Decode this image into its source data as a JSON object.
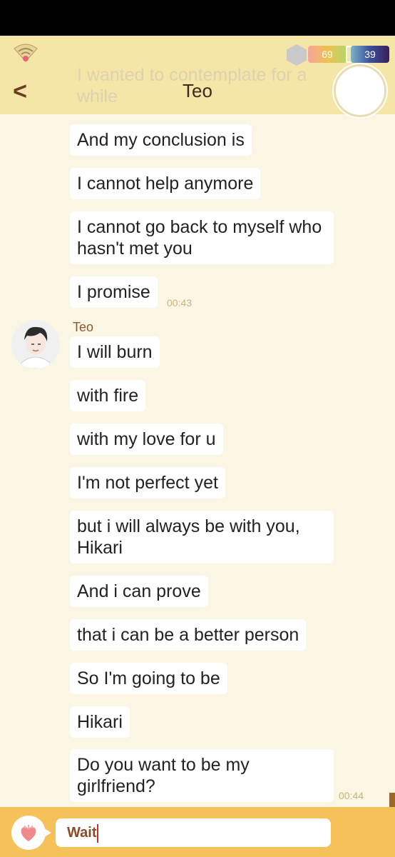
{
  "header": {
    "title": "Teo",
    "ghost_text": "I wanted to contemplate for a while",
    "meter_a_value": "69",
    "meter_b_value": "39",
    "back_label": "<"
  },
  "chat": {
    "sender_name": "Teo",
    "messages": [
      {
        "text": "And my conclusion is"
      },
      {
        "text": "I cannot help anymore"
      },
      {
        "text": "I cannot go back to myself who hasn't met you"
      },
      {
        "text": "I promise",
        "time": "00:43"
      },
      {
        "text": "I will burn"
      },
      {
        "text": "with fire"
      },
      {
        "text": "with my love for u"
      },
      {
        "text": "I'm not perfect yet"
      },
      {
        "text": "but i will always be with you, Hikari"
      },
      {
        "text": "And i can prove"
      },
      {
        "text": "that i can be a better person"
      },
      {
        "text": "So I'm going to be"
      },
      {
        "text": "Hikari"
      },
      {
        "text": "Do you want to be my girlfriend?",
        "time": "00:44"
      }
    ]
  },
  "input": {
    "value": "Wait"
  },
  "icons": {
    "wifi": "wifi-icon",
    "heart": "heart-icon",
    "hexagon": "hexagon-icon"
  },
  "colors": {
    "header_bg": "#f5e6a8",
    "chat_bg": "#fbf5e4",
    "input_bar_bg": "#f7c15a",
    "sender_name": "#8c5a2e"
  }
}
